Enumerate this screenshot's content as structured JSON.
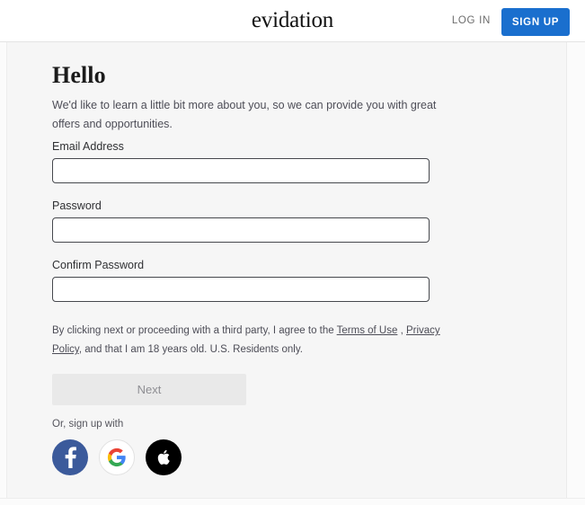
{
  "header": {
    "logo_text": "evidation",
    "login_label": "LOG IN",
    "signup_label": "SIGN UP",
    "signup_color": "#1a6fce"
  },
  "main": {
    "heading": "Hello",
    "subtext": "We'd like to learn a little bit more about you, so we can provide you with great offers and opportunities.",
    "fields": [
      {
        "label": "Email Address",
        "value": "",
        "placeholder": ""
      },
      {
        "label": "Password",
        "value": "",
        "placeholder": ""
      },
      {
        "label": "Confirm Password",
        "value": "",
        "placeholder": ""
      }
    ],
    "legal": {
      "part1": "By clicking next or proceeding with a third party, I agree to the ",
      "terms_link": "Terms of Use",
      "part2": " , ",
      "privacy_link": "Privacy Policy",
      "part3": ", and that I am 18 years old. U.S. Residents only."
    },
    "next_label": "Next",
    "next_disabled": true,
    "or_label": "Or, sign up with",
    "social": [
      {
        "name": "facebook",
        "icon": "facebook-icon",
        "color": "#3b5a9b"
      },
      {
        "name": "google",
        "icon": "google-icon",
        "color": "#ffffff"
      },
      {
        "name": "apple",
        "icon": "apple-icon",
        "color": "#000000"
      }
    ]
  }
}
